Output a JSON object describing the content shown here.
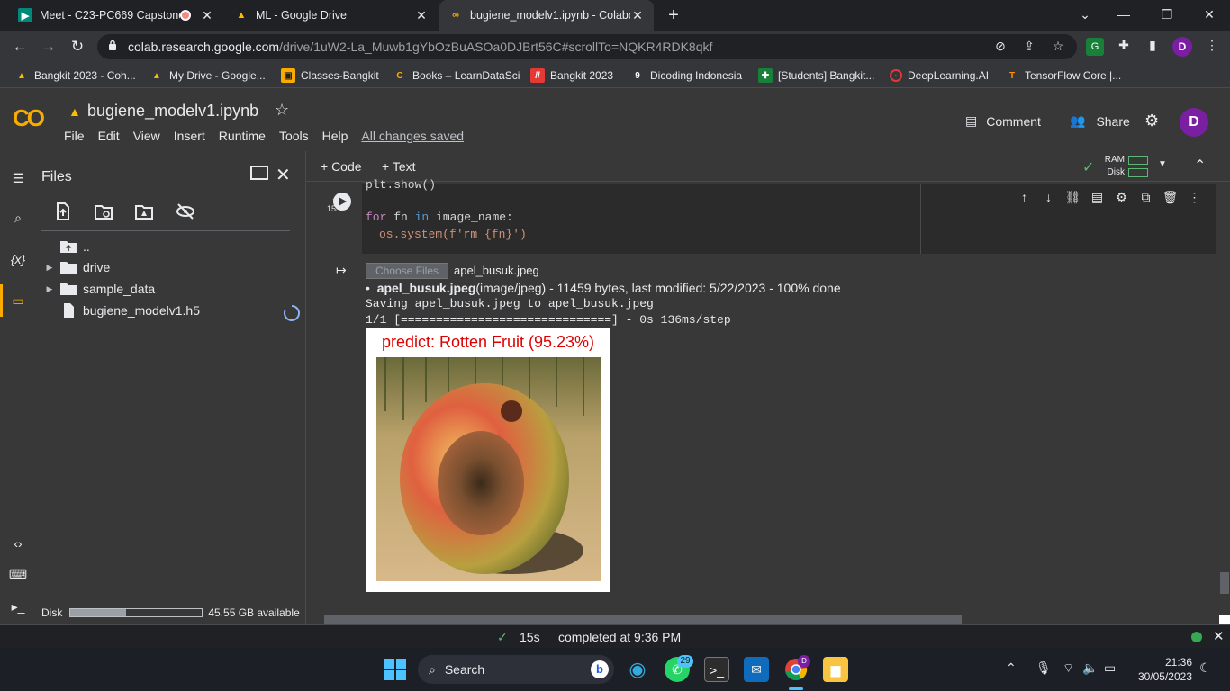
{
  "browser": {
    "tabs": [
      {
        "title": "Meet - C23-PC669 Capstone",
        "active": false
      },
      {
        "title": "ML - Google Drive",
        "active": false
      },
      {
        "title": "bugiene_modelv1.ipynb - Colabo",
        "active": true
      }
    ],
    "url_host": "colab.research.google.com",
    "url_path": "/drive/1uW2-La_Muwb1gYbOzBuASOa0DJBrt56C#scrollTo=NQKR4RDK8qkf",
    "profile_initial": "D",
    "bookmarks": [
      "Bangkit 2023 - Coh...",
      "My Drive - Google...",
      "Classes-Bangkit",
      "Books – LearnDataSci",
      "Bangkit 2023",
      "Dicoding Indonesia",
      "[Students] Bangkit...",
      "DeepLearning.AI",
      "TensorFlow Core |..."
    ]
  },
  "colab": {
    "logo": "CO",
    "notebook_title": "bugiene_modelv1.ipynb",
    "menu": [
      "File",
      "Edit",
      "View",
      "Insert",
      "Runtime",
      "Tools",
      "Help"
    ],
    "saved_status": "All changes saved",
    "comment_label": "Comment",
    "share_label": "Share",
    "user_initial": "D",
    "add_code": "+ Code",
    "add_text": "+ Text",
    "ram_label": "RAM",
    "disk_label": "Disk"
  },
  "sidebar": {
    "title": "Files",
    "tree": [
      {
        "name": "..",
        "type": "up"
      },
      {
        "name": "drive",
        "type": "folder"
      },
      {
        "name": "sample_data",
        "type": "folder"
      },
      {
        "name": "bugiene_modelv1.h5",
        "type": "file"
      }
    ],
    "disk_label": "Disk",
    "disk_available": "45.55 GB available",
    "disk_used_fraction": 0.42
  },
  "cell": {
    "exec_time": "15s",
    "code_line1": "plt.show()",
    "code_line2_kw": "for",
    "code_line2_var": " fn ",
    "code_line2_in": "in",
    "code_line2_rest": " image_name:",
    "code_line3": "os.system(f'rm {fn}')"
  },
  "output": {
    "choose_files": "Choose Files",
    "chosen_file": "apel_busuk.jpeg",
    "file_name_bold": "apel_busuk.jpeg",
    "file_meta": "(image/jpeg) - 11459 bytes, last modified: 5/22/2023 - 100% done",
    "saving": "Saving apel_busuk.jpeg to apel_busuk.jpeg",
    "progress": "1/1 [==============================] - 0s 136ms/step",
    "prediction": "predict: Rotten Fruit (95.23%)"
  },
  "status": {
    "check_time": "15s",
    "completed": "completed at 9:36 PM"
  },
  "taskbar": {
    "search": "Search",
    "whatsapp_badge": "29",
    "time": "21:36",
    "date": "30/05/2023"
  }
}
